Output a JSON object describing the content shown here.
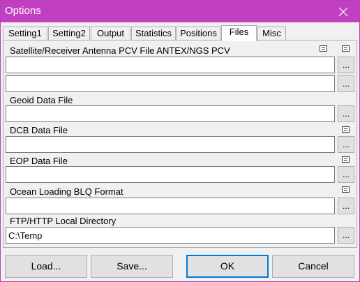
{
  "window": {
    "title": "Options",
    "close_symbol": "✕"
  },
  "tabs": [
    {
      "label": "Setting1",
      "active": false
    },
    {
      "label": "Setting2",
      "active": false
    },
    {
      "label": "Output",
      "active": false
    },
    {
      "label": "Statistics",
      "active": false
    },
    {
      "label": "Positions",
      "active": false
    },
    {
      "label": "Files",
      "active": true
    },
    {
      "label": "Misc",
      "active": false
    }
  ],
  "files": {
    "antenna_label": "Satellite/Receiver Antenna PCV File ANTEX/NGS PCV",
    "antenna_sat_value": "",
    "antenna_rcv_value": "",
    "geoid_label": "Geoid Data File",
    "geoid_value": "",
    "dcb_label": "DCB Data File",
    "dcb_value": "",
    "eop_label": "EOP Data File",
    "eop_value": "",
    "blq_label": "Ocean Loading BLQ Format",
    "blq_value": "",
    "ftp_label": "FTP/HTTP Local Directory",
    "ftp_value": "C:\\Temp",
    "browse_label": "...",
    "view_icon": "file-view-icon"
  },
  "buttons": {
    "load": "Load...",
    "save": "Save...",
    "ok": "OK",
    "cancel": "Cancel"
  },
  "colors": {
    "titlebar": "#c23fc2",
    "default_button_border": "#0078d7"
  }
}
